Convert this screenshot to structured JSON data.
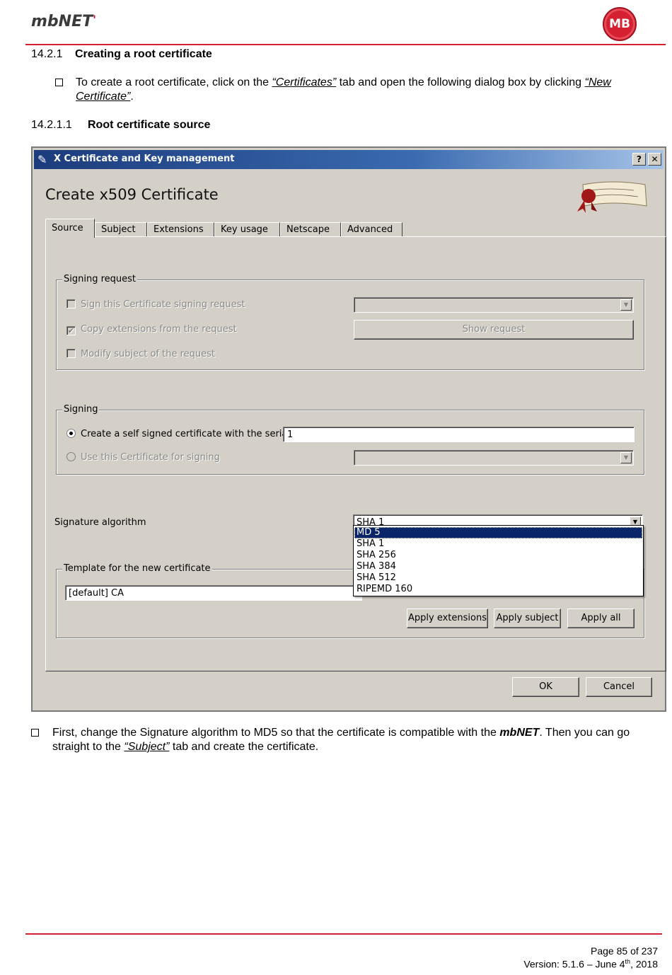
{
  "header": {
    "logo": "mbNET",
    "logo_mark": "'",
    "badge": "MB"
  },
  "section": {
    "number": "14.2.1",
    "title": "Creating a root certificate"
  },
  "intro": {
    "pre": "To create a root certificate, click on the ",
    "link1": "“Certificates”",
    "mid": " tab and open the following dialog box by clicking ",
    "link2": "“New Certificate”",
    "post": "."
  },
  "subsection": {
    "number": "14.2.1.1",
    "title": "Root certificate source"
  },
  "dialog": {
    "window_title": "X Certificate and Key management",
    "help_btn": "?",
    "close_btn": "✕",
    "heading": "Create x509 Certificate",
    "tabs": [
      "Source",
      "Subject",
      "Extensions",
      "Key usage",
      "Netscape",
      "Advanced"
    ],
    "signing_request": {
      "legend": "Signing request",
      "sign_csr": "Sign this Certificate signing request",
      "copy_ext": "Copy extensions from the request",
      "modify_subject": "Modify subject of the request",
      "show_request": "Show request"
    },
    "signing": {
      "legend": "Signing",
      "self_signed": "Create a self signed certificate with the serial",
      "serial": "1",
      "use_cert": "Use this Certificate for signing"
    },
    "signature_algorithm": {
      "label": "Signature algorithm",
      "selected": "SHA 1",
      "options": [
        "MD 5",
        "SHA 1",
        "SHA 256",
        "SHA 384",
        "SHA 512",
        "RIPEMD 160"
      ]
    },
    "template": {
      "legend": "Template for the new certificate",
      "value": "[default] CA",
      "apply_extensions": "Apply extensions",
      "apply_subject": "Apply subject",
      "apply_all": "Apply all"
    },
    "ok": "OK",
    "cancel": "Cancel"
  },
  "instruction": {
    "pre": "First, change the Signature algorithm to MD5 so that the certificate is compatible with the ",
    "product": "mbNET",
    "mid": ". Then you can go straight to the ",
    "link": "“Subject”",
    "post": " tab and create the certificate."
  },
  "footer": {
    "page": "Page 85 of 237",
    "version_pre": "Version: 5.1.6 – June 4",
    "version_sup": "th",
    "version_post": ", 2018"
  }
}
